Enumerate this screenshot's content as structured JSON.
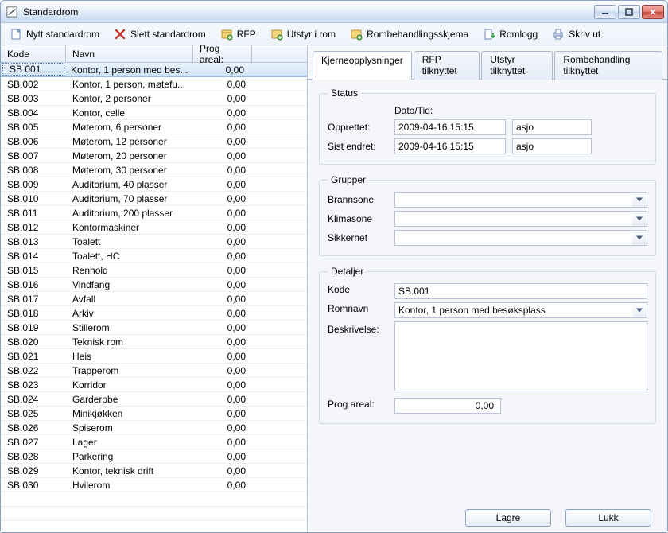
{
  "window": {
    "title": "Standardrom"
  },
  "toolbar": [
    {
      "id": "new",
      "label": "Nytt standardrom",
      "icon": "page-icon"
    },
    {
      "id": "delete",
      "label": "Slett standardrom",
      "icon": "delete-icon"
    },
    {
      "id": "rfp",
      "label": "RFP",
      "icon": "rfp-icon"
    },
    {
      "id": "equip",
      "label": "Utstyr i rom",
      "icon": "equip-icon"
    },
    {
      "id": "treat",
      "label": "Rombehandlingsskjema",
      "icon": "treat-icon"
    },
    {
      "id": "log",
      "label": "Romlogg",
      "icon": "log-icon"
    },
    {
      "id": "print",
      "label": "Skriv ut",
      "icon": "print-icon"
    }
  ],
  "grid": {
    "columns": {
      "kode": "Kode",
      "navn": "Navn",
      "areal": "Prog areal:"
    },
    "rows": [
      {
        "kode": "SB.001",
        "navn": "Kontor, 1 person med bes...",
        "areal": "0,00",
        "selected": true
      },
      {
        "kode": "SB.002",
        "navn": "Kontor, 1 person, møtefu...",
        "areal": "0,00"
      },
      {
        "kode": "SB.003",
        "navn": "Kontor, 2 personer",
        "areal": "0,00"
      },
      {
        "kode": "SB.004",
        "navn": "Kontor, celle",
        "areal": "0,00"
      },
      {
        "kode": "SB.005",
        "navn": "Møterom, 6 personer",
        "areal": "0,00"
      },
      {
        "kode": "SB.006",
        "navn": "Møterom, 12 personer",
        "areal": "0,00"
      },
      {
        "kode": "SB.007",
        "navn": "Møterom, 20 personer",
        "areal": "0,00"
      },
      {
        "kode": "SB.008",
        "navn": "Møterom, 30 personer",
        "areal": "0,00"
      },
      {
        "kode": "SB.009",
        "navn": "Auditorium, 40 plasser",
        "areal": "0,00"
      },
      {
        "kode": "SB.010",
        "navn": "Auditorium, 70 plasser",
        "areal": "0,00"
      },
      {
        "kode": "SB.011",
        "navn": "Auditorium, 200 plasser",
        "areal": "0,00"
      },
      {
        "kode": "SB.012",
        "navn": "Kontormaskiner",
        "areal": "0,00"
      },
      {
        "kode": "SB.013",
        "navn": "Toalett",
        "areal": "0,00"
      },
      {
        "kode": "SB.014",
        "navn": "Toalett, HC",
        "areal": "0,00"
      },
      {
        "kode": "SB.015",
        "navn": "Renhold",
        "areal": "0,00"
      },
      {
        "kode": "SB.016",
        "navn": "Vindfang",
        "areal": "0,00"
      },
      {
        "kode": "SB.017",
        "navn": "Avfall",
        "areal": "0,00"
      },
      {
        "kode": "SB.018",
        "navn": "Arkiv",
        "areal": "0,00"
      },
      {
        "kode": "SB.019",
        "navn": "Stillerom",
        "areal": "0,00"
      },
      {
        "kode": "SB.020",
        "navn": "Teknisk rom",
        "areal": "0,00"
      },
      {
        "kode": "SB.021",
        "navn": "Heis",
        "areal": "0,00"
      },
      {
        "kode": "SB.022",
        "navn": "Trapperom",
        "areal": "0,00"
      },
      {
        "kode": "SB.023",
        "navn": "Korridor",
        "areal": "0,00"
      },
      {
        "kode": "SB.024",
        "navn": "Garderobe",
        "areal": "0,00"
      },
      {
        "kode": "SB.025",
        "navn": "Minikjøkken",
        "areal": "0,00"
      },
      {
        "kode": "SB.026",
        "navn": "Spiserom",
        "areal": "0,00"
      },
      {
        "kode": "SB.027",
        "navn": "Lager",
        "areal": "0,00"
      },
      {
        "kode": "SB.028",
        "navn": "Parkering",
        "areal": "0,00"
      },
      {
        "kode": "SB.029",
        "navn": "Kontor, teknisk drift",
        "areal": "0,00"
      },
      {
        "kode": "SB.030",
        "navn": "Hvilerom",
        "areal": "0,00"
      }
    ]
  },
  "tabs": [
    {
      "id": "core",
      "label": "Kjerneopplysninger",
      "active": true
    },
    {
      "id": "rfp",
      "label": "RFP tilknyttet"
    },
    {
      "id": "equip",
      "label": "Utstyr tilknyttet"
    },
    {
      "id": "treat",
      "label": "Rombehandling tilknyttet"
    }
  ],
  "panel": {
    "status": {
      "legend": "Status",
      "dateHeader": "Dato/Tid:",
      "createdLabel": "Opprettet:",
      "createdDate": "2009-04-16 15:15",
      "createdUser": "asjo",
      "modifiedLabel": "Sist endret:",
      "modifiedDate": "2009-04-16 15:15",
      "modifiedUser": "asjo"
    },
    "groups": {
      "legend": "Grupper",
      "brannsoneLabel": "Brannsone",
      "klimasoneLabel": "Klimasone",
      "sikkerhetLabel": "Sikkerhet",
      "brannsone": "",
      "klimasone": "",
      "sikkerhet": ""
    },
    "details": {
      "legend": "Detaljer",
      "kodeLabel": "Kode",
      "kode": "SB.001",
      "romnavnLabel": "Romnavn",
      "romnavn": "Kontor, 1 person med besøksplass",
      "beskrivelseLabel": "Beskrivelse:",
      "beskrivelse": "",
      "arealLabel": "Prog areal:",
      "areal": "0,00"
    }
  },
  "footer": {
    "save": "Lagre",
    "close": "Lukk"
  }
}
